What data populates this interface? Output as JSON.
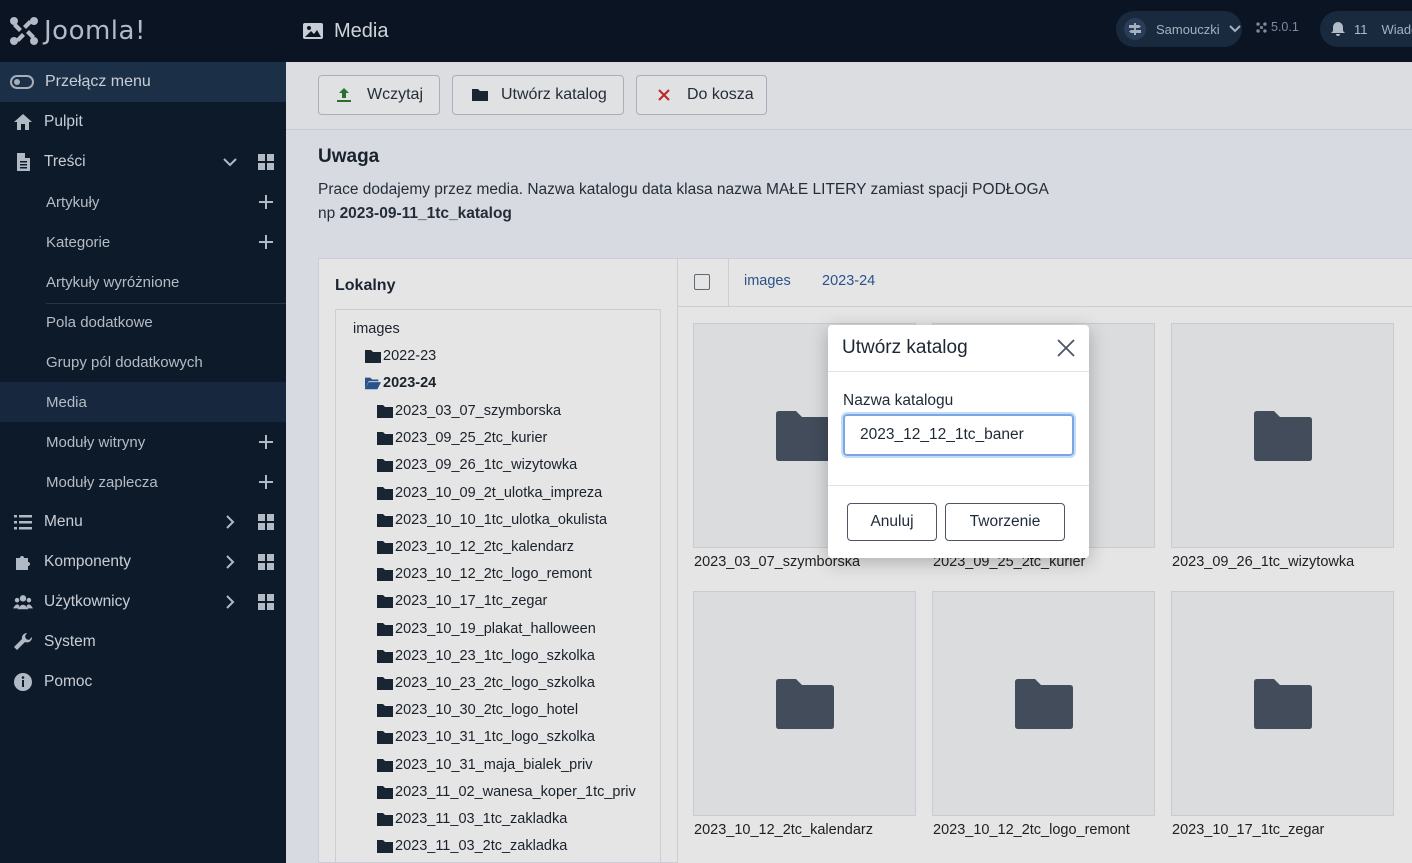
{
  "app": {
    "logo_text": "Joomla!",
    "page_title": "Media"
  },
  "header": {
    "site_name": "Samouczki",
    "version": "5.0.1",
    "notifications_count": "11",
    "notifications_label": "Wiado"
  },
  "sidebar": {
    "toggle_label": "Przełącz menu",
    "dashboard": "Pulpit",
    "content": "Treści",
    "content_items": [
      {
        "label": "Artykuły",
        "add": true
      },
      {
        "label": "Kategorie",
        "add": true
      },
      {
        "label": "Artykuły wyróżnione",
        "add": false
      },
      {
        "label": "Pola dodatkowe",
        "add": false
      },
      {
        "label": "Grupy pól dodatkowych",
        "add": false
      },
      {
        "label": "Media",
        "add": false
      },
      {
        "label": "Moduły witryny",
        "add": true
      },
      {
        "label": "Moduły zaplecza",
        "add": true
      }
    ],
    "menu": "Menu",
    "components": "Komponenty",
    "users": "Użytkownicy",
    "system": "System",
    "help": "Pomoc"
  },
  "toolbar": {
    "upload_label": "Wczytaj",
    "mkdir_label": "Utwórz katalog",
    "trash_label": "Do kosza"
  },
  "notice": {
    "title": "Uwaga",
    "line1": "Prace dodajemy przez media. Nazwa katalogu  data klasa nazwa  MAŁE LITERY zamiast spacji PODŁOGA",
    "line2_prefix": "np ",
    "line2_example": "2023-09-11_1tc_katalog"
  },
  "tree": {
    "header": "Lokalny",
    "root": "images",
    "folders": [
      "2022-23",
      "2023-24"
    ],
    "subfolders": [
      "2023_03_07_szymborska",
      "2023_09_25_2tc_kurier",
      "2023_09_26_1tc_wizytowka",
      "2023_10_09_2t_ulotka_impreza",
      "2023_10_10_1tc_ulotka_okulista",
      "2023_10_12_2tc_kalendarz",
      "2023_10_12_2tc_logo_remont",
      "2023_10_17_1tc_zegar",
      "2023_10_19_plakat_halloween",
      "2023_10_23_1tc_logo_szkolka",
      "2023_10_23_2tc_logo_szkolka",
      "2023_10_30_2tc_logo_hotel",
      "2023_10_31_1tc_logo_szkolka",
      "2023_10_31_maja_bialek_priv",
      "2023_11_02_wanesa_koper_1tc_priv",
      "2023_11_03_1tc_zakladka",
      "2023_11_03_2tc_zakladka"
    ]
  },
  "breadcrumb": [
    "images",
    "2023-24"
  ],
  "tiles": [
    "2023_03_07_szymborska",
    "2023_09_25_2tc_kurier",
    "2023_09_26_1tc_wizytowka",
    "2023_10_12_2tc_kalendarz",
    "2023_10_12_2tc_logo_remont",
    "2023_10_17_1tc_zegar"
  ],
  "modal": {
    "title": "Utwórz katalog",
    "field_label": "Nazwa katalogu",
    "field_value": "2023_12_12_1tc_baner",
    "cancel_label": "Anuluj",
    "create_label": "Tworzenie"
  },
  "colors": {
    "sidebar_bg": "#0f1d2e",
    "header_bg": "#0c1727",
    "accent_link": "#2f5d9a",
    "trash_red": "#d32f2f",
    "upload_green": "#2e7d32"
  }
}
